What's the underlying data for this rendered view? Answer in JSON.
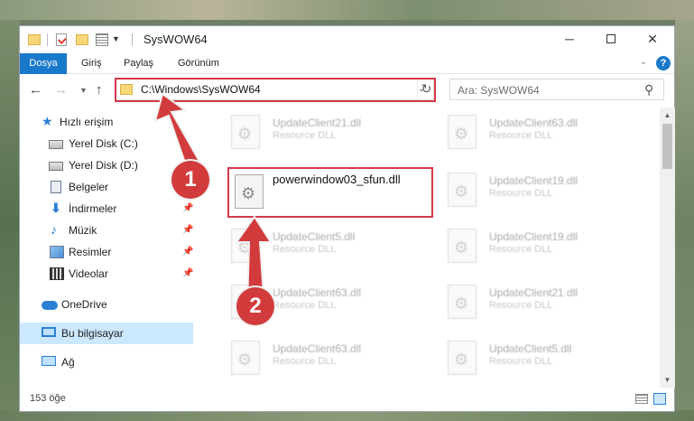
{
  "window": {
    "title": "SysWOW64"
  },
  "ribbon": {
    "tabs": [
      "Dosya",
      "Giriş",
      "Paylaş",
      "Görünüm"
    ]
  },
  "nav": {
    "address": "C:\\Windows\\SysWOW64",
    "search_placeholder": "Ara: SysWOW64"
  },
  "sidebar": {
    "items": [
      {
        "label": "Hızlı erişim",
        "icon": "star-icon"
      },
      {
        "label": "Yerel Disk (C:)",
        "icon": "drive-icon"
      },
      {
        "label": "Yerel Disk (D:)",
        "icon": "drive-icon"
      },
      {
        "label": "Belgeler",
        "icon": "documents-icon"
      },
      {
        "label": "İndirmeler",
        "icon": "download-icon"
      },
      {
        "label": "Müzik",
        "icon": "music-icon"
      },
      {
        "label": "Resimler",
        "icon": "pictures-icon"
      },
      {
        "label": "Videolar",
        "icon": "videos-icon"
      },
      {
        "label": "OneDrive",
        "icon": "cloud-icon"
      },
      {
        "label": "Bu bilgisayar",
        "icon": "computer-icon"
      },
      {
        "label": "Ağ",
        "icon": "network-icon"
      }
    ]
  },
  "files": {
    "main": {
      "name": "powerwindow03_sfun.dll"
    },
    "left": [
      {
        "name": "UpdateClient21.dll",
        "type": "Resource DLL"
      },
      {
        "name": "UpdateClient5.dll",
        "type": "Resource DLL"
      },
      {
        "name": "UpdateClient63.dll",
        "type": "Resource DLL"
      },
      {
        "name": "UpdateClient63.dll",
        "type": "Resource DLL"
      }
    ],
    "right": [
      {
        "name": "UpdateClient63.dll",
        "type": "Resource DLL"
      },
      {
        "name": "UpdateClient19.dll",
        "type": "Resource DLL"
      },
      {
        "name": "UpdateClient19.dll",
        "type": "Resource DLL"
      },
      {
        "name": "UpdateClient21.dll",
        "type": "Resource DLL"
      },
      {
        "name": "UpdateClient5.dll",
        "type": "Resource DLL"
      }
    ]
  },
  "status": {
    "count": "153 öğe"
  },
  "annotations": {
    "step1": "1",
    "step2": "2"
  },
  "colors": {
    "accent": "#1979ca",
    "highlight": "#d6394a",
    "selected": "#cce8ff"
  }
}
